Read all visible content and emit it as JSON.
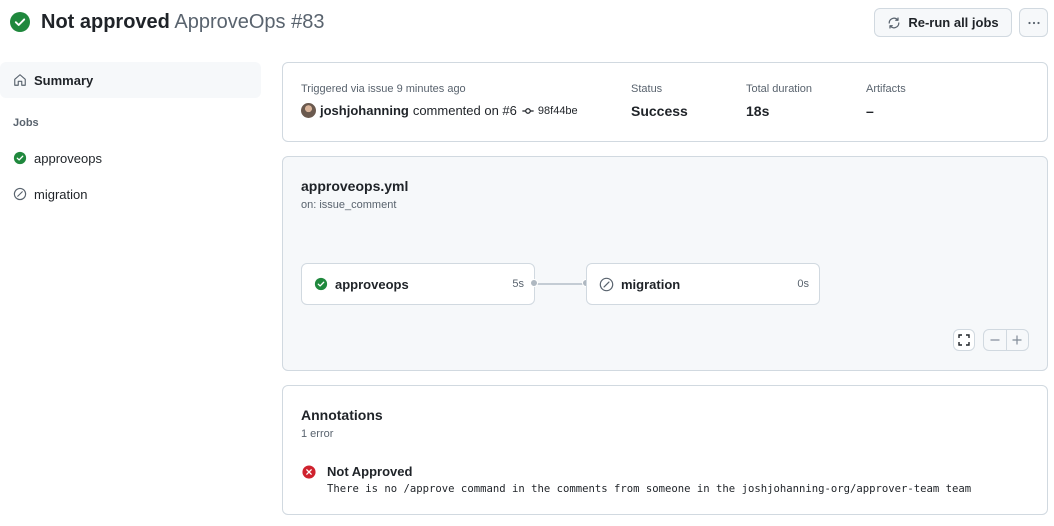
{
  "header": {
    "status_text": "Not approved",
    "run_name": "ApproveOps #83",
    "status_icon": "check-circle-fill-icon",
    "rerun_label": "Re-run all jobs",
    "rerun_icon": "sync-icon",
    "more_icon": "kebab-horizontal-icon"
  },
  "sidebar": {
    "summary_label": "Summary",
    "summary_icon": "home-icon",
    "jobs_heading": "Jobs",
    "jobs": [
      {
        "label": "approveops",
        "status": "success",
        "icon": "check-circle-fill-icon"
      },
      {
        "label": "migration",
        "status": "skipped",
        "icon": "skip-icon"
      }
    ]
  },
  "summary": {
    "trigger_label": "Triggered via issue 9 minutes ago",
    "user": "joshjohanning",
    "action_text": "commented on #6",
    "commit_sha": "98f44be",
    "stats": [
      {
        "key": "Status",
        "value": "Success"
      },
      {
        "key": "Total duration",
        "value": "18s"
      },
      {
        "key": "Artifacts",
        "value": "–"
      }
    ]
  },
  "workflow": {
    "file": "approveops.yml",
    "trigger": "on: issue_comment",
    "jobs": [
      {
        "name": "approveops",
        "duration": "5s",
        "status": "success"
      },
      {
        "name": "migration",
        "duration": "0s",
        "status": "skipped"
      }
    ],
    "controls": {
      "fullscreen_icon": "screen-full-icon",
      "zoom_out_icon": "minus-icon",
      "zoom_in_icon": "plus-icon"
    }
  },
  "annotations": {
    "title": "Annotations",
    "count": "1 error",
    "items": [
      {
        "level": "error",
        "title": "Not Approved",
        "message": "There is no /approve command in the comments from someone in the joshjohanning-org/approver-team team"
      }
    ]
  },
  "colors": {
    "success": "#1f883d",
    "error": "#cf222e",
    "muted": "#59636e",
    "border": "#d1d9e0"
  }
}
